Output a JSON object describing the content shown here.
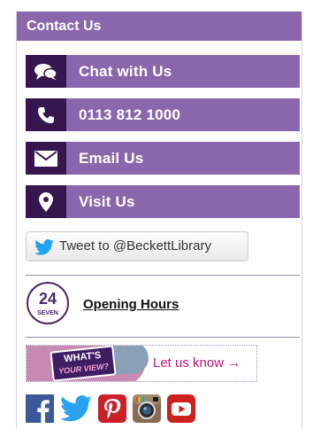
{
  "panel": {
    "title": "Contact Us"
  },
  "contact_items": [
    {
      "label": "Chat with Us",
      "icon": "chat-bubbles-icon"
    },
    {
      "label": "0113 812 1000",
      "icon": "phone-icon"
    },
    {
      "label": "Email Us",
      "icon": "envelope-icon"
    },
    {
      "label": "Visit Us",
      "icon": "map-pin-icon"
    }
  ],
  "tweet": {
    "label": "Tweet to @BeckettLibrary",
    "icon": "twitter-bird-icon"
  },
  "opening_hours": {
    "badge_number": "24",
    "badge_text": "SEVEN",
    "link_label": "Opening Hours"
  },
  "feedback_banner": {
    "badge_line1": "WHAT'S",
    "badge_line2": "YOUR VIEW?",
    "cta": "Let us know →"
  },
  "social": [
    "facebook-icon",
    "twitter-icon",
    "pinterest-icon",
    "instagram-icon",
    "youtube-icon"
  ],
  "colors": {
    "header_purple": "#8a67ac",
    "icon_box_dark": "#35164f",
    "cta_magenta": "#c1127d",
    "facebook": "#3b5998",
    "twitter": "#1da1f2",
    "pinterest": "#cb2027",
    "youtube": "#cd201f"
  }
}
